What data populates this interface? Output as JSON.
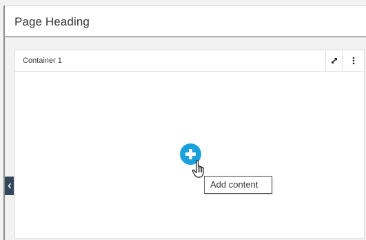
{
  "header": {
    "title": "Page Heading"
  },
  "container": {
    "title": "Container 1",
    "expand_icon": "expand-arrows-icon",
    "menu_icon": "vertical-ellipsis-icon"
  },
  "sidebar_toggle": {
    "icon": "chevron-left-icon"
  },
  "add_content": {
    "icon": "plus-circle-icon",
    "tooltip": "Add content"
  },
  "colors": {
    "accent": "#1aa0dc",
    "sidebar_toggle": "#33475b",
    "page_background": "#f2f2f2"
  }
}
